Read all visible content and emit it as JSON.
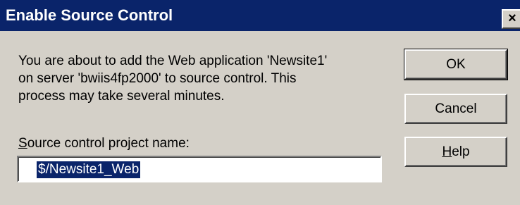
{
  "dialog": {
    "title": "Enable Source Control",
    "close_glyph": "×",
    "message": "You are about to add the Web application 'Newsite1'\non server 'bwiis4fp2000' to source control. This\nprocess may take several minutes.",
    "field": {
      "label_mnemonic": "S",
      "label_rest": "ource control project name:",
      "value": "$/Newsite1_Web"
    },
    "buttons": {
      "ok": "OK",
      "cancel": "Cancel",
      "help_mnemonic": "H",
      "help_rest": "elp"
    }
  },
  "colors": {
    "titlebar": "#0a246a",
    "face": "#d4d0c8",
    "selection": "#0a246a"
  }
}
